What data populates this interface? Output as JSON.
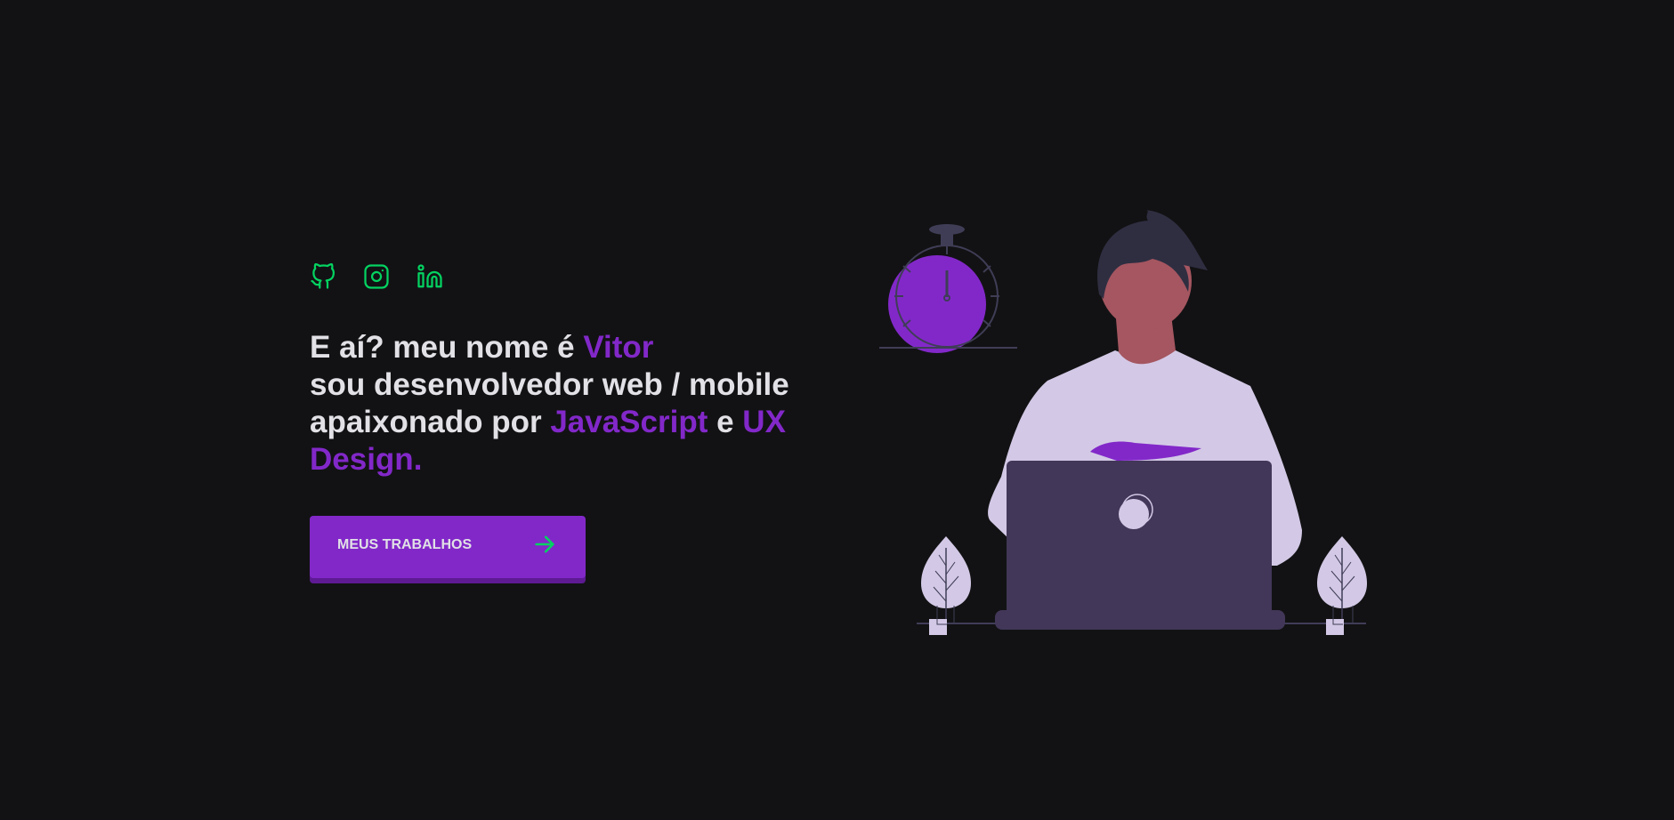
{
  "hero": {
    "socials": [
      {
        "name": "github-icon"
      },
      {
        "name": "instagram-icon"
      },
      {
        "name": "linkedin-icon"
      }
    ],
    "line1_prefix": "E aí? meu nome é ",
    "line1_name": "Vitor",
    "line2": "sou desenvolvedor web / mobile",
    "line3_prefix": "apaixonado por ",
    "line3_tech": "JavaScript",
    "line3_mid": " e ",
    "line3_ux": "UX",
    "line4": "Design.",
    "cta_label": "MEUS TRABALHOS"
  },
  "colors": {
    "background": "#121214",
    "accent": "#8228c9",
    "icon": "#04d361",
    "text": "#e1e1e6"
  },
  "illustration": {
    "icon": "developer-at-laptop-illustration"
  }
}
